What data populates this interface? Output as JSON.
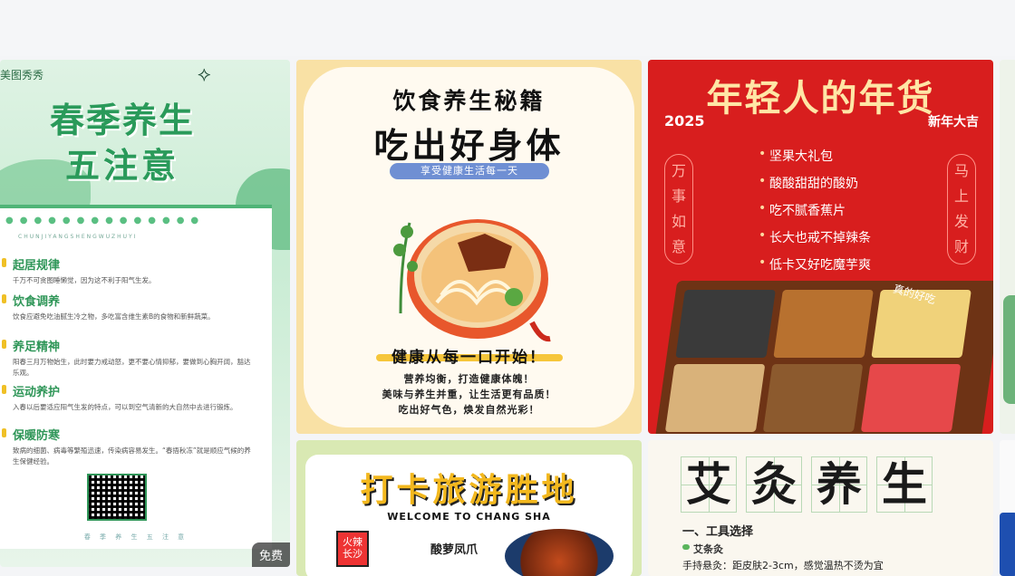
{
  "cards": {
    "spring": {
      "brand": "美图秀秀",
      "title_line1": "春季养生",
      "title_line2": "五注意",
      "pinyin": "CHUNJIYANGSHENGWUZHUYI",
      "sections": [
        {
          "heading": "起居规律",
          "body": "千万不可贪图睡懒觉，因为这不利于阳气生发。"
        },
        {
          "heading": "饮食调养",
          "body": "饮食应避免吃油腻生冷之物，多吃富含维生素B的食物和新鲜蔬菜。"
        },
        {
          "heading": "养足精神",
          "body": "阳春三月万物始生，此时要力戒动怒，更不要心情抑郁，要做到心胸开阔，豁达乐观。"
        },
        {
          "heading": "运动养护",
          "body": "入春以后要适应阳气生发的特点，可以到空气清新的大自然中去进行锻炼。"
        },
        {
          "heading": "保暖防寒",
          "body": "致病的细菌、病毒等繁殖迅速，传染病容易发生。“春捂秋冻”就是顺应气候的养生保健经验。"
        }
      ],
      "footer": "春 季 养 生 五 注 意",
      "badge": "免费"
    },
    "diet": {
      "title_line1": "饮食养生秘籍",
      "title_line2": "吃出好身体",
      "pill": "享受健康生活每一天",
      "slogan": "健康从每一口开始！",
      "lines": [
        "营养均衡，打造健康体魄！",
        "美味与养生并重，让生活更有品质！",
        "吃出好气色，焕发自然光彩！"
      ]
    },
    "newyear": {
      "title": "年轻人的年货",
      "year": "2025",
      "wish": "新年大吉",
      "left_side": [
        "万",
        "事",
        "如",
        "意"
      ],
      "right_side": [
        "马",
        "上",
        "发",
        "财"
      ],
      "items": [
        "坚果大礼包",
        "酸酸甜甜的酸奶",
        "吃不腻香蕉片",
        "长大也戒不掉辣条",
        "低卡又好吃魔芋爽"
      ],
      "tag": "真的好吃"
    },
    "travel": {
      "title": "打卡旅游胜地",
      "subtitle": "WELCOME TO CHANG SHA",
      "stamp": "火辣长沙",
      "dish": "酸萝凤爪"
    },
    "moxa": {
      "chars": [
        "艾",
        "灸",
        "养",
        "生"
      ],
      "section": "一、工具选择",
      "item": "艾条灸",
      "detail": "手持悬灸：距皮肤2-3cm，感觉温热不烫为宜"
    }
  },
  "colors": {
    "spring_green": "#2a9a5a",
    "new_year_red": "#d81e1e",
    "diet_yellow": "#f9e1a5",
    "travel_yellow": "#f3b81e"
  }
}
